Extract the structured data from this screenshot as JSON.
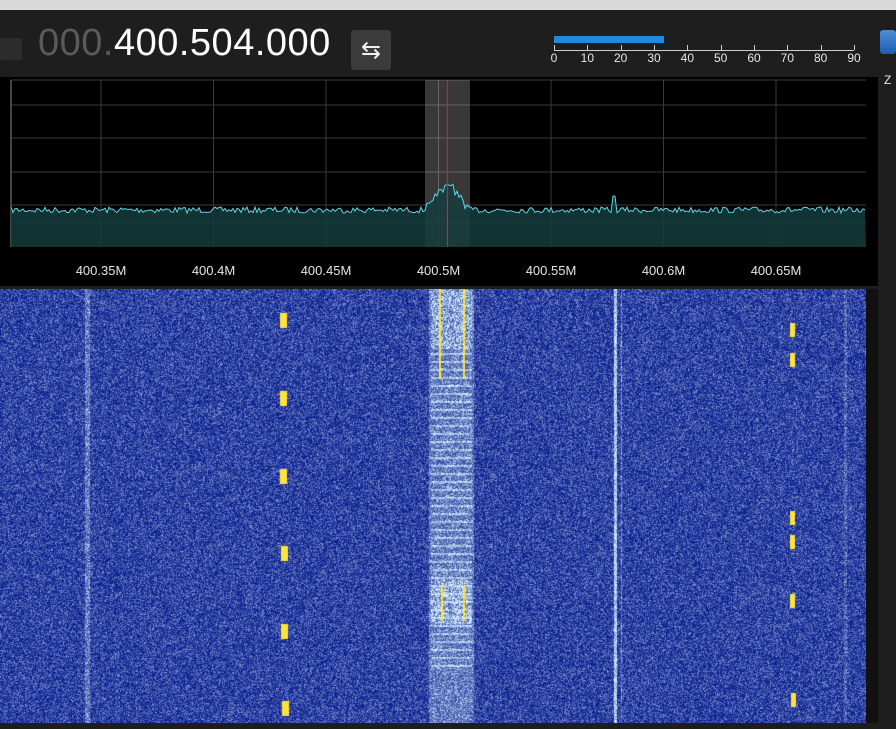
{
  "frequency": {
    "dim_prefix": "000.",
    "value": "400.504.000"
  },
  "swap_button": {
    "glyph": "⇆"
  },
  "level_meter": {
    "fill_value": 33,
    "max": 90,
    "labels": [
      "0",
      "10",
      "20",
      "30",
      "40",
      "50",
      "60",
      "70",
      "80",
      "90"
    ]
  },
  "right_panel": {
    "letter": "Z"
  },
  "spectrum": {
    "x_range": [
      400.31,
      400.69
    ],
    "tune_frequency": 400.504,
    "passband": [
      400.494,
      400.514
    ],
    "ticks": [
      "400.35M",
      "400.4M",
      "400.45M",
      "400.5M",
      "400.55M",
      "400.6M",
      "400.65M"
    ],
    "tick_values": [
      400.35,
      400.4,
      400.45,
      400.5,
      400.55,
      400.6,
      400.65
    ],
    "colors": {
      "trace": "#5fd6e6",
      "fill": "#143c3c",
      "tune_line": "#e02020",
      "grid": "#3a3a3a"
    }
  },
  "waterfall": {
    "colors": {
      "background": "#0a1c8e",
      "signal": "#ffe23a"
    }
  }
}
